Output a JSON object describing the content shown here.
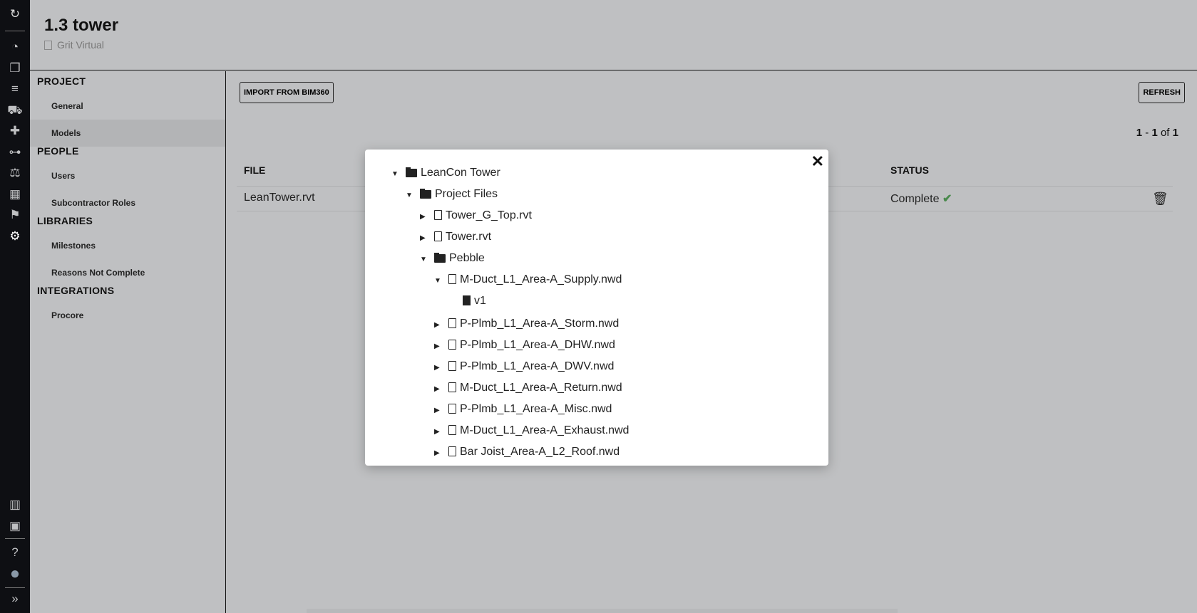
{
  "rail": {
    "top_icons": [
      "logo-icon",
      "dashboard-icon",
      "cubes-icon",
      "list-icon",
      "dolly-icon",
      "puzzle-icon",
      "hierarchy-icon",
      "balance-scale-icon",
      "calendar-icon",
      "flag-checkered-icon",
      "gear-icon"
    ],
    "bottom_icons": [
      "building-icon",
      "contact-card-icon",
      "help-icon",
      "avatar",
      "expand-icon"
    ]
  },
  "header": {
    "title": "1.3 tower",
    "subtitle": "Grit Virtual"
  },
  "nav": {
    "sections": [
      {
        "label": "PROJECT",
        "items": [
          {
            "label": "General"
          },
          {
            "label": "Models",
            "active": true
          }
        ]
      },
      {
        "label": "PEOPLE",
        "items": [
          {
            "label": "Users"
          },
          {
            "label": "Subcontractor Roles"
          }
        ]
      },
      {
        "label": "LIBRARIES",
        "items": [
          {
            "label": "Milestones"
          },
          {
            "label": "Reasons Not Complete"
          }
        ]
      },
      {
        "label": "INTEGRATIONS",
        "items": [
          {
            "label": "Procore"
          }
        ]
      }
    ]
  },
  "toolbar": {
    "import_label": "IMPORT FROM BIM360",
    "refresh_label": "REFRESH"
  },
  "pager": {
    "start": "1",
    "sep": " - ",
    "end": "1",
    "of": " of ",
    "total": "1"
  },
  "table": {
    "columns": {
      "file": "FILE",
      "status": "STATUS"
    },
    "rows": [
      {
        "file": "LeanTower.rvt",
        "status": "Complete",
        "status_icon": "check-icon"
      }
    ]
  },
  "colors": {
    "accent_success": "#4a8a4d",
    "rail": "#0e0f13"
  },
  "modal": {
    "close": "✕",
    "tree": [
      {
        "label": "LeanCon Tower",
        "level": 0,
        "type": "folder",
        "expanded": true
      },
      {
        "label": "Project Files",
        "level": 1,
        "type": "folder",
        "expanded": true
      },
      {
        "label": "Tower_G_Top.rvt",
        "level": 2,
        "type": "file",
        "expanded": false
      },
      {
        "label": "Tower.rvt",
        "level": 2,
        "type": "file",
        "expanded": false
      },
      {
        "label": "Pebble",
        "level": 2,
        "type": "folder",
        "expanded": true
      },
      {
        "label": "M-Duct_L1_Area-A_Supply.nwd",
        "level": 3,
        "type": "file",
        "expanded": true
      },
      {
        "label": "v1",
        "level": 4,
        "type": "version"
      },
      {
        "label": "P-Plmb_L1_Area-A_Storm.nwd",
        "level": 3,
        "type": "file",
        "expanded": false
      },
      {
        "label": "P-Plmb_L1_Area-A_DHW.nwd",
        "level": 3,
        "type": "file",
        "expanded": false
      },
      {
        "label": "P-Plmb_L1_Area-A_DWV.nwd",
        "level": 3,
        "type": "file",
        "expanded": false
      },
      {
        "label": "M-Duct_L1_Area-A_Return.nwd",
        "level": 3,
        "type": "file",
        "expanded": false
      },
      {
        "label": "P-Plmb_L1_Area-A_Misc.nwd",
        "level": 3,
        "type": "file",
        "expanded": false
      },
      {
        "label": "M-Duct_L1_Area-A_Exhaust.nwd",
        "level": 3,
        "type": "file",
        "expanded": false
      },
      {
        "label": "Bar Joist_Area-A_L2_Roof.nwd",
        "level": 3,
        "type": "file",
        "expanded": false
      }
    ]
  }
}
